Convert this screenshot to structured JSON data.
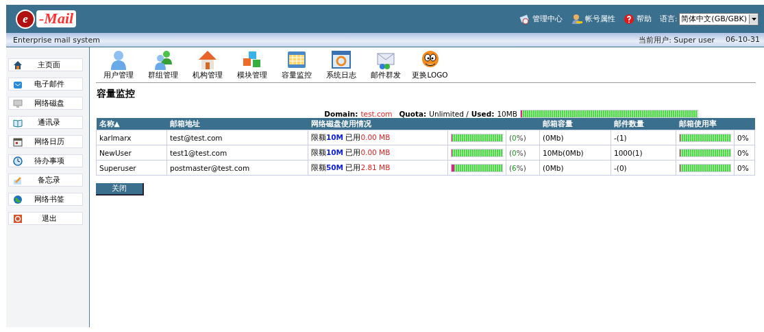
{
  "header": {
    "logo": "-Mail",
    "logo_initial": "e",
    "links": [
      {
        "kind": "admin",
        "label": "管理中心"
      },
      {
        "kind": "account",
        "label": "帐号属性"
      },
      {
        "kind": "help",
        "label": "帮助"
      }
    ],
    "language_label": "语言:",
    "language_value": "简体中文(GB/GBK)"
  },
  "subheader": {
    "tagline": "Enterprise mail system",
    "current_user": "当前用户: Super user",
    "date": "06-10-31"
  },
  "sidebar": {
    "items": [
      {
        "kind": "home",
        "label": "主页面"
      },
      {
        "kind": "mail",
        "label": "电子邮件"
      },
      {
        "kind": "disk",
        "label": "网络磁盘"
      },
      {
        "kind": "contacts",
        "label": "通讯录"
      },
      {
        "kind": "calendar",
        "label": "网络日历"
      },
      {
        "kind": "todo",
        "label": "待办事项"
      },
      {
        "kind": "memo",
        "label": "备忘录"
      },
      {
        "kind": "bookmark",
        "label": "网络书签"
      },
      {
        "kind": "logout",
        "label": "退出"
      }
    ]
  },
  "toolbar": [
    {
      "kind": "user",
      "label": "用户管理"
    },
    {
      "kind": "group",
      "label": "群组管理"
    },
    {
      "kind": "org",
      "label": "机构管理"
    },
    {
      "kind": "module",
      "label": "模块管理"
    },
    {
      "kind": "capacity",
      "label": "容量监控"
    },
    {
      "kind": "log",
      "label": "系统日志"
    },
    {
      "kind": "mass",
      "label": "邮件群发"
    },
    {
      "kind": "logo",
      "label": "更换LOGO"
    }
  ],
  "page_title": "容量监控",
  "domain_summary": {
    "domain_label": "Domain:",
    "domain": "test.com",
    "quota_label": "Quota:",
    "quota": "Unlimited /",
    "used_label": "Used:",
    "used": "10MB",
    "level": 0
  },
  "table": {
    "columns": [
      "名称▲",
      "邮箱地址",
      "网络磁盘使用情况",
      "邮箱容量",
      "邮件数量",
      "邮箱使用率"
    ],
    "rows": [
      {
        "name": "karlmarx",
        "email": "test@test.com",
        "limit_label": "限额",
        "limit": "10M",
        "used_label": "已用",
        "used": "0.00 MB",
        "disk": {
          "level": 0
        },
        "pct_open": "(",
        "pct": "0",
        "pct_close": "%)",
        "capacity": "(0Mb)",
        "count": "-(1)",
        "mailbox": {
          "level": 0
        },
        "usage": "0%"
      },
      {
        "name": "NewUser",
        "email": "test1@test.com",
        "limit_label": "限额",
        "limit": "10M",
        "used_label": "已用",
        "used": "0.00 MB",
        "disk": {
          "level": 0
        },
        "pct_open": "(",
        "pct": "0",
        "pct_close": "%)",
        "capacity": "10Mb(0Mb)",
        "count": "1000(1)",
        "mailbox": {
          "level": 0
        },
        "usage": "0%"
      },
      {
        "name": "Superuser",
        "email": "postmaster@test.com",
        "limit_label": "限额",
        "limit": "50M",
        "used_label": "已用",
        "used": "2.81 MB",
        "disk": {
          "level": 0.06
        },
        "pct_open": "(",
        "pct": "6",
        "pct_close": "%)",
        "capacity": "(0Mb)",
        "count": "-(0)",
        "mailbox": {
          "level": 0
        },
        "usage": "0%"
      }
    ]
  },
  "close_button": "关闭"
}
